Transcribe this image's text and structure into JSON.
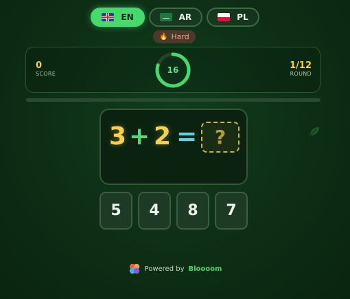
{
  "languages": [
    {
      "code": "EN",
      "flag": "uk-flag-icon",
      "active": true
    },
    {
      "code": "AR",
      "flag": "saudi-flag-icon",
      "active": false
    },
    {
      "code": "PL",
      "flag": "poland-flag-icon",
      "active": false
    }
  ],
  "difficulty": {
    "label": "Hard",
    "icon": "fire-icon"
  },
  "score": {
    "value": "0",
    "label": "SCORE"
  },
  "timer": {
    "value": "16",
    "fraction_remaining": 0.8
  },
  "round": {
    "value": "1/12",
    "label": "ROUND"
  },
  "progress": {
    "fraction": 0
  },
  "question": {
    "operand1": "3",
    "operator": "+",
    "operand2": "2",
    "equals": "=",
    "placeholder": "?"
  },
  "options": [
    "5",
    "4",
    "8",
    "7"
  ],
  "footer": {
    "prefix": "Powered by",
    "brand": "Bloooom"
  },
  "colors": {
    "accent": "#45d96e",
    "number": "#f7d14a",
    "background": "#0d2e15"
  }
}
